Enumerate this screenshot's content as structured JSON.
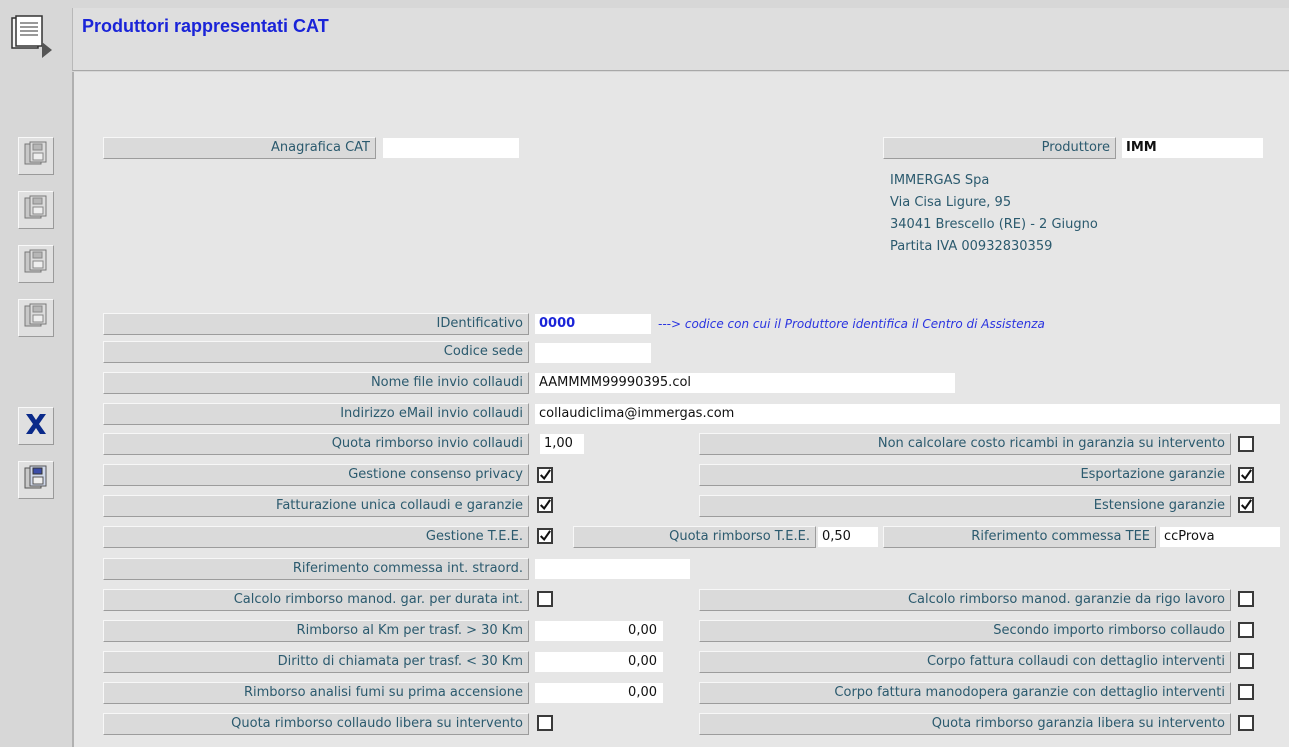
{
  "window": {
    "title": "Produttori rappresentati CAT"
  },
  "toolbar": {
    "buttons": [
      {
        "name": "floppy-disk-icon-1"
      },
      {
        "name": "floppy-disk-icon-2"
      },
      {
        "name": "floppy-disk-icon-3"
      },
      {
        "name": "floppy-disk-icon-4"
      },
      {
        "name": "close-icon"
      },
      {
        "name": "save-icon"
      }
    ],
    "icon_color_close": "#0a2a8a"
  },
  "form": {
    "anagrafica_cat": {
      "label": "Anagrafica CAT",
      "value": ""
    },
    "produttore": {
      "label": "Produttore",
      "value": "IMM"
    },
    "produttore_address": [
      "IMMERGAS Spa",
      "Via Cisa Ligure, 95",
      "34041 Brescello (RE) - 2 Giugno",
      "Partita IVA 00932830359"
    ],
    "identificativo": {
      "label": "IDentificativo",
      "value": "0000",
      "note": "---> codice con cui il Produttore identifica il Centro di Assistenza"
    },
    "codice_sede": {
      "label": "Codice sede",
      "value": ""
    },
    "nome_file": {
      "label": "Nome file invio collaudi",
      "value": "AAMMMM99990395.col"
    },
    "indirizzo_email": {
      "label": "Indirizzo eMail invio collaudi",
      "value": "collaudiclima@immergas.com"
    },
    "quota_rimborso_collaudi": {
      "label": "Quota rimborso invio collaudi",
      "value": "1,00"
    },
    "non_calcolare": {
      "label": "Non calcolare costo ricambi in garanzia su intervento",
      "checked": false
    },
    "gestione_privacy": {
      "label": "Gestione consenso privacy",
      "checked": true
    },
    "esportazione_garanzie": {
      "label": "Esportazione garanzie",
      "checked": true
    },
    "fatturazione_unica": {
      "label": "Fatturazione unica collaudi e garanzie",
      "checked": true
    },
    "estensione_garanzie": {
      "label": "Estensione garanzie",
      "checked": true
    },
    "gestione_tee": {
      "label": "Gestione T.E.E.",
      "checked": true
    },
    "quota_rimborso_tee": {
      "label": "Quota rimborso T.E.E.",
      "value": "0,50"
    },
    "riferimento_tee": {
      "label": "Riferimento commessa TEE",
      "value": "ccProva"
    },
    "riferimento_straord": {
      "label": "Riferimento commessa int. straord.",
      "value": ""
    },
    "calcolo_durata": {
      "label": "Calcolo rimborso manod. gar. per durata int.",
      "checked": false
    },
    "calcolo_rigo": {
      "label": "Calcolo rimborso manod. garanzie da rigo lavoro",
      "checked": false
    },
    "rimborso_km": {
      "label": "Rimborso al Km per trasf. > 30 Km",
      "value": "0,00"
    },
    "secondo_importo": {
      "label": "Secondo importo rimborso collaudo",
      "checked": false
    },
    "diritto_chiamata": {
      "label": "Diritto di chiamata per trasf. < 30 Km",
      "value": "0,00"
    },
    "corpo_collaudi": {
      "label": "Corpo fattura collaudi con dettaglio interventi",
      "checked": false
    },
    "rimborso_fumi": {
      "label": "Rimborso analisi fumi su prima accensione",
      "value": "0,00"
    },
    "corpo_manodopera": {
      "label": "Corpo fattura manodopera garanzie con dettaglio interventi",
      "checked": false
    },
    "quota_collaudo_libera": {
      "label": "Quota rimborso collaudo libera su intervento",
      "checked": false
    },
    "quota_garanzia_libera": {
      "label": "Quota rimborso garanzia libera su intervento",
      "checked": false
    }
  }
}
